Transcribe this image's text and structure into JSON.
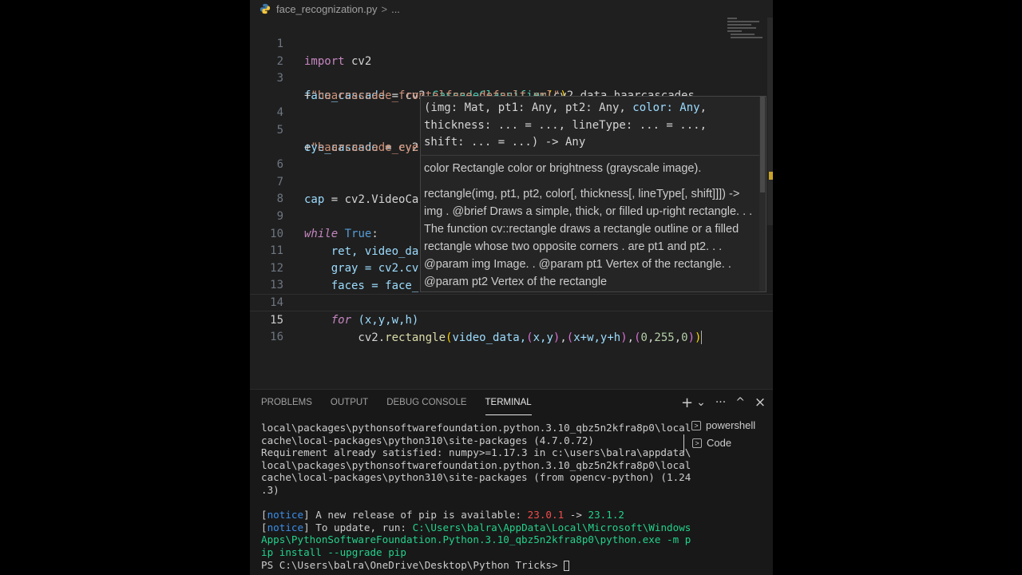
{
  "breadcrumb": {
    "file": "face_recognization.py",
    "sep": ">",
    "rest": "..."
  },
  "editor": {
    "active_line": "15",
    "line_numbers": [
      "1",
      "2",
      "3",
      "4",
      "5",
      "6",
      "7",
      "8",
      "9",
      "10",
      "11",
      "12",
      "13",
      "14",
      "15",
      "16"
    ],
    "lines": {
      "l1": {
        "kw": "import",
        "rest": " cv2"
      },
      "l3a": {
        "var": "face_cascade",
        "eq": " = cv2.",
        "cls": "CascadeClassifier",
        "br": "(",
        "rest": "cv2.data.haarcascades"
      },
      "l3b": {
        "plus": "+",
        "str": "\"haarcascade_frontalface_default.xml\"",
        "br": ")"
      },
      "l5a": {
        "var": "eye_cascade",
        "rest": " = cv2"
      },
      "l5b": {
        "plus": "+",
        "str": "\"haarcascade_eye"
      },
      "l7": {
        "var": "cap",
        "rest": " = cv2.VideoCa"
      },
      "l9": {
        "kw": "while",
        "true": " True",
        "colon": ":"
      },
      "l10": {
        "text": "    ret, video_da"
      },
      "l11": {
        "text": "    gray = cv2.cv"
      },
      "l12": {
        "text": "    faces = face_"
      },
      "l14": {
        "kw": "    for",
        "rest": " (x,y,w,h)"
      },
      "l15": {
        "pre": "        cv2.",
        "fn": "rectangle",
        "b1": "(",
        "arg1": "video_data,",
        "b2": "(",
        "arg2": "x,y",
        "b2c": ")",
        "c1": ",",
        "b3": "(",
        "arg3": "x+w,y+h",
        "b3c": ")",
        "c2": ",",
        "b4": "(",
        "n1": "0",
        "c3": ",",
        "n2": "255",
        "c4": ",",
        "n3": "0",
        "b4c": ")",
        "b1c": ")"
      }
    }
  },
  "hover": {
    "signature_line1_pre": "(img: Mat, pt1: Any, pt2: Any, ",
    "signature_line1_hl": "color: Any",
    "signature_line1_post": ",",
    "signature_line2": "thickness: ... = ..., lineType: ... = ...,",
    "signature_line3": "shift: ... = ...) -> Any",
    "param_doc": "color Rectangle color or brightness (grayscale image).",
    "doc": "rectangle(img, pt1, pt2, color[, thickness[, lineType[, shift]]]) -> img . @brief Draws a simple, thick, or filled up-right rectangle. . . The function cv::rectangle draws a rectangle outline or a filled rectangle whose two opposite corners . are pt1 and pt2. . . @param img Image. . @param pt1 Vertex of the rectangle. . @param pt2 Vertex of the rectangle"
  },
  "panel": {
    "tabs": [
      "PROBLEMS",
      "OUTPUT",
      "DEBUG CONSOLE",
      "TERMINAL"
    ],
    "active_tab": "TERMINAL",
    "actions": {
      "add": "+",
      "chevron": "⌄",
      "more": "···",
      "maximize": "^",
      "close": "×"
    },
    "terminal_lines": [
      "local\\packages\\pythonsoftwarefoundation.python.3.10_qbz5n2kfra8p0\\local",
      "cache\\local-packages\\python310\\site-packages (4.7.0.72)",
      "Requirement already satisfied: numpy>=1.17.3 in c:\\users\\balra\\appdata\\",
      "local\\packages\\pythonsoftwarefoundation.python.3.10_qbz5n2kfra8p0\\local",
      "cache\\local-packages\\python310\\site-packages (from opencv-python) (1.24",
      ".3)"
    ],
    "notice1": {
      "tag": "notice",
      "text": " A new release of pip is available: ",
      "old": "23.0.1",
      "arrow": " -> ",
      "new": "23.1.2"
    },
    "notice2": {
      "tag": "notice",
      "text": " To update, run: ",
      "cmd1": "C:\\Users\\balra\\AppData\\Local\\Microsoft\\Windows",
      "cmd2": "Apps\\PythonSoftwareFoundation.Python.3.10_qbz5n2kfra8p0\\python.exe -m p",
      "cmd3": "ip install --upgrade pip"
    },
    "prompt": "PS C:\\Users\\balra\\OneDrive\\Desktop\\Python Tricks> ",
    "terminal_list": [
      "powershell",
      "Code"
    ]
  }
}
